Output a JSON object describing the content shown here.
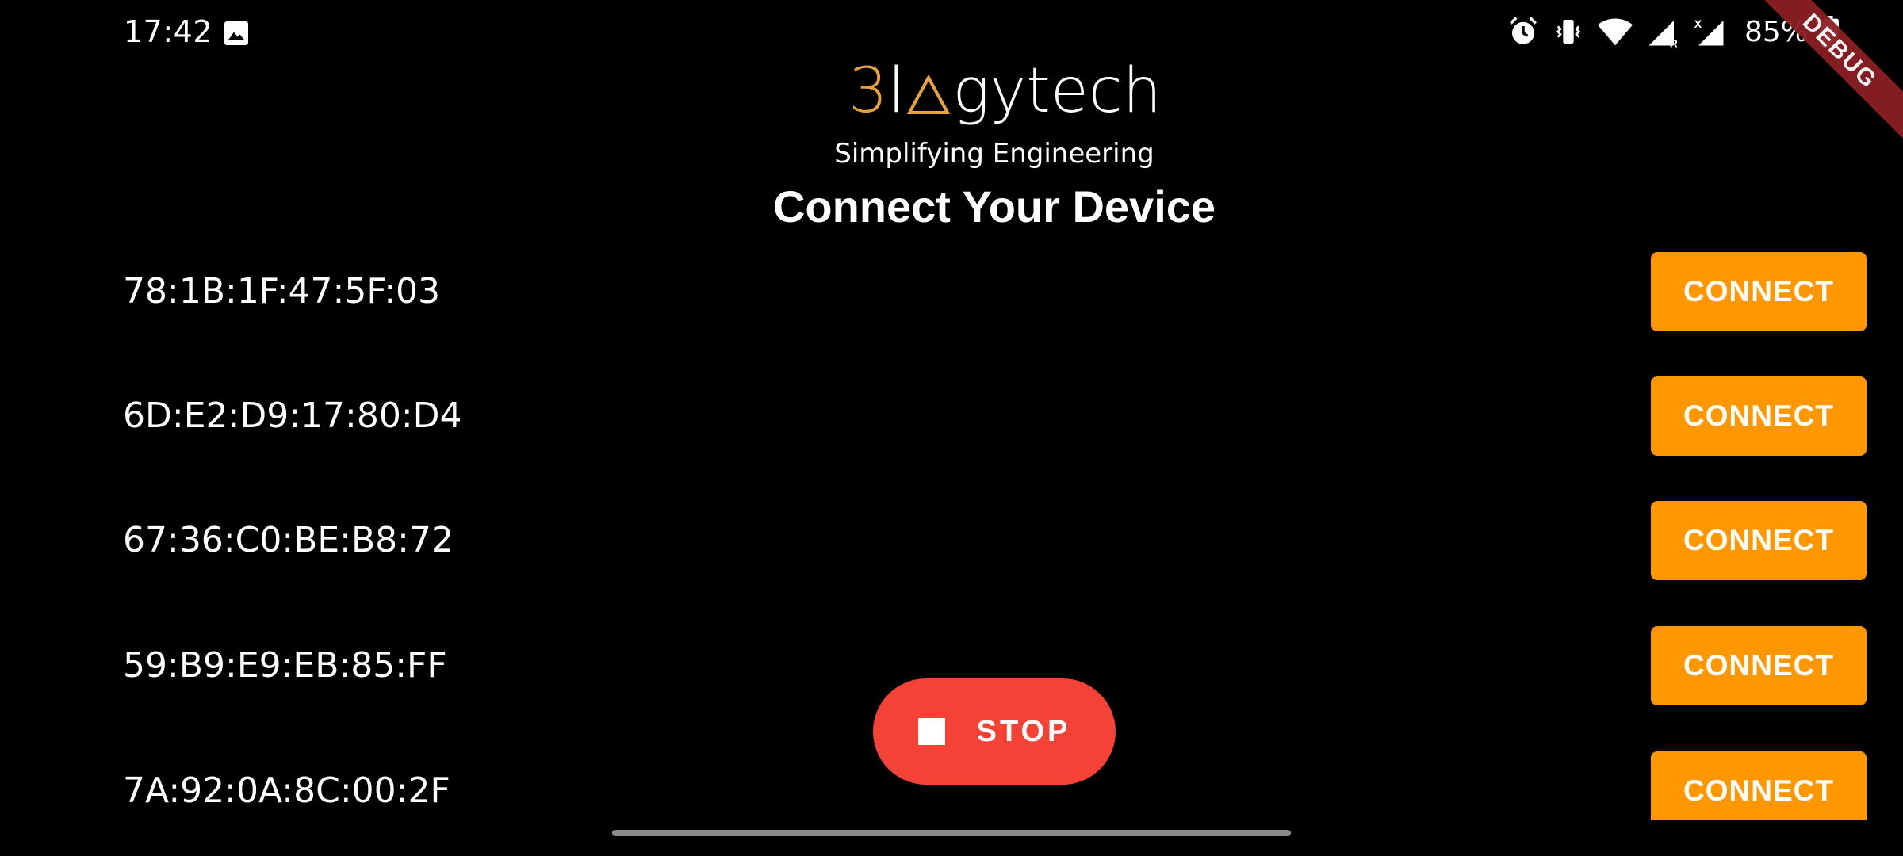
{
  "status_bar": {
    "time": "17:42",
    "battery_percent": "85%",
    "icons": [
      "gallery-icon",
      "alarm-icon",
      "vibrate-icon",
      "wifi-icon",
      "signal-r-icon",
      "signal-x-icon",
      "signal-icon",
      "battery-icon"
    ]
  },
  "debug_banner": "DEBUG",
  "logo": {
    "part1": "3",
    "part2": "l",
    "part3": "gytech",
    "tagline": "Simplifying Engineering",
    "accent_color": "#e8a33b"
  },
  "page_title": "Connect Your Device",
  "devices": [
    {
      "address": "78:1B:1F:47:5F:03",
      "button_label": "CONNECT"
    },
    {
      "address": "6D:E2:D9:17:80:D4",
      "button_label": "CONNECT"
    },
    {
      "address": "67:36:C0:BE:B8:72",
      "button_label": "CONNECT"
    },
    {
      "address": "59:B9:E9:EB:85:FF",
      "button_label": "CONNECT"
    },
    {
      "address": "7A:92:0A:8C:00:2F",
      "button_label": "CONNECT"
    }
  ],
  "stop_button": {
    "label": "STOP",
    "icon": "stop-icon",
    "color": "#f44336"
  },
  "colors": {
    "connect_button": "#ff9800",
    "background": "#000000"
  }
}
